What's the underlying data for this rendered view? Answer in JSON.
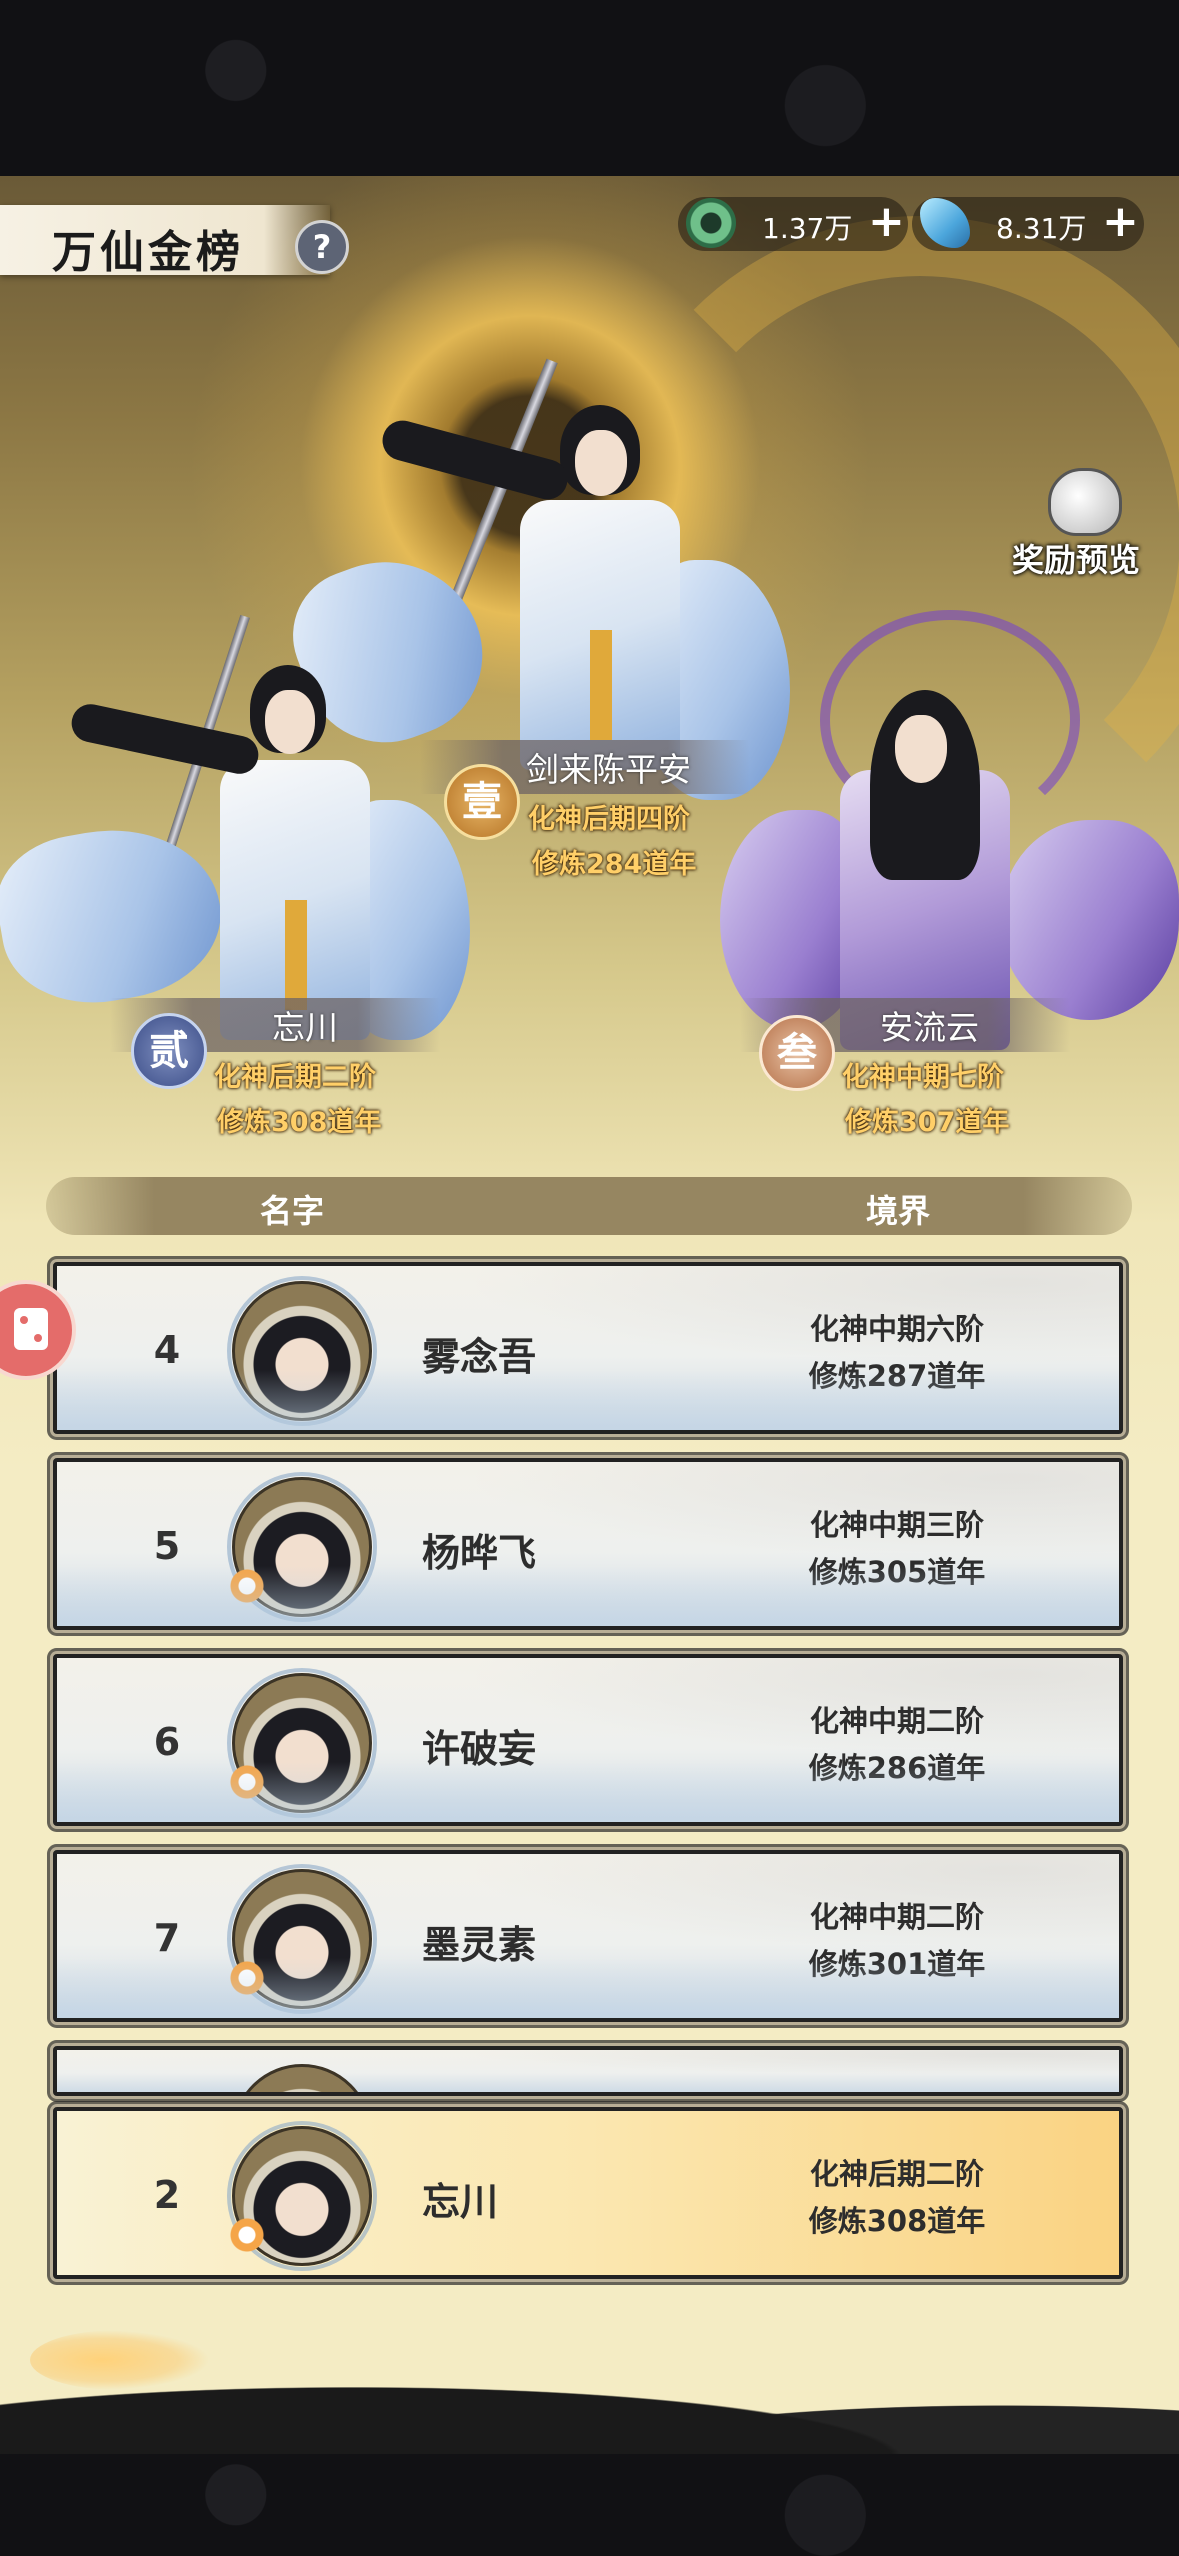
{
  "header": {
    "title": "万仙金榜",
    "help_label": "?",
    "resources": [
      {
        "icon": "jade-ring-icon",
        "value": "1.37万",
        "plus": "+"
      },
      {
        "icon": "spirit-crystal-icon",
        "value": "8.31万",
        "plus": "+"
      }
    ],
    "reward_preview_label": "奖励预览"
  },
  "podium": [
    {
      "rank_glyph": "壹",
      "name": "剑来陈平安",
      "realm": "化神后期四阶",
      "cultivation": "修炼284道年"
    },
    {
      "rank_glyph": "贰",
      "name": "忘川",
      "realm": "化神后期二阶",
      "cultivation": "修炼308道年"
    },
    {
      "rank_glyph": "叁",
      "name": "安流云",
      "realm": "化神中期七阶",
      "cultivation": "修炼307道年"
    }
  ],
  "list": {
    "col_name": "名字",
    "col_realm": "境界",
    "rows": [
      {
        "rank": "4",
        "name": "雾念吾",
        "realm": "化神中期六阶",
        "cultivation": "修炼287道年"
      },
      {
        "rank": "5",
        "name": "杨晔飞",
        "realm": "化神中期三阶",
        "cultivation": "修炼305道年"
      },
      {
        "rank": "6",
        "name": "许破妄",
        "realm": "化神中期二阶",
        "cultivation": "修炼286道年"
      },
      {
        "rank": "7",
        "name": "墨灵素",
        "realm": "化神中期二阶",
        "cultivation": "修炼301道年"
      }
    ]
  },
  "my_rank": {
    "rank": "2",
    "name": "忘川",
    "realm": "化神后期二阶",
    "cultivation": "修炼308道年"
  },
  "colors": {
    "gold_text": "#ffcf68",
    "highlight_row": "#fad383",
    "badge_gold": "#b57325"
  }
}
